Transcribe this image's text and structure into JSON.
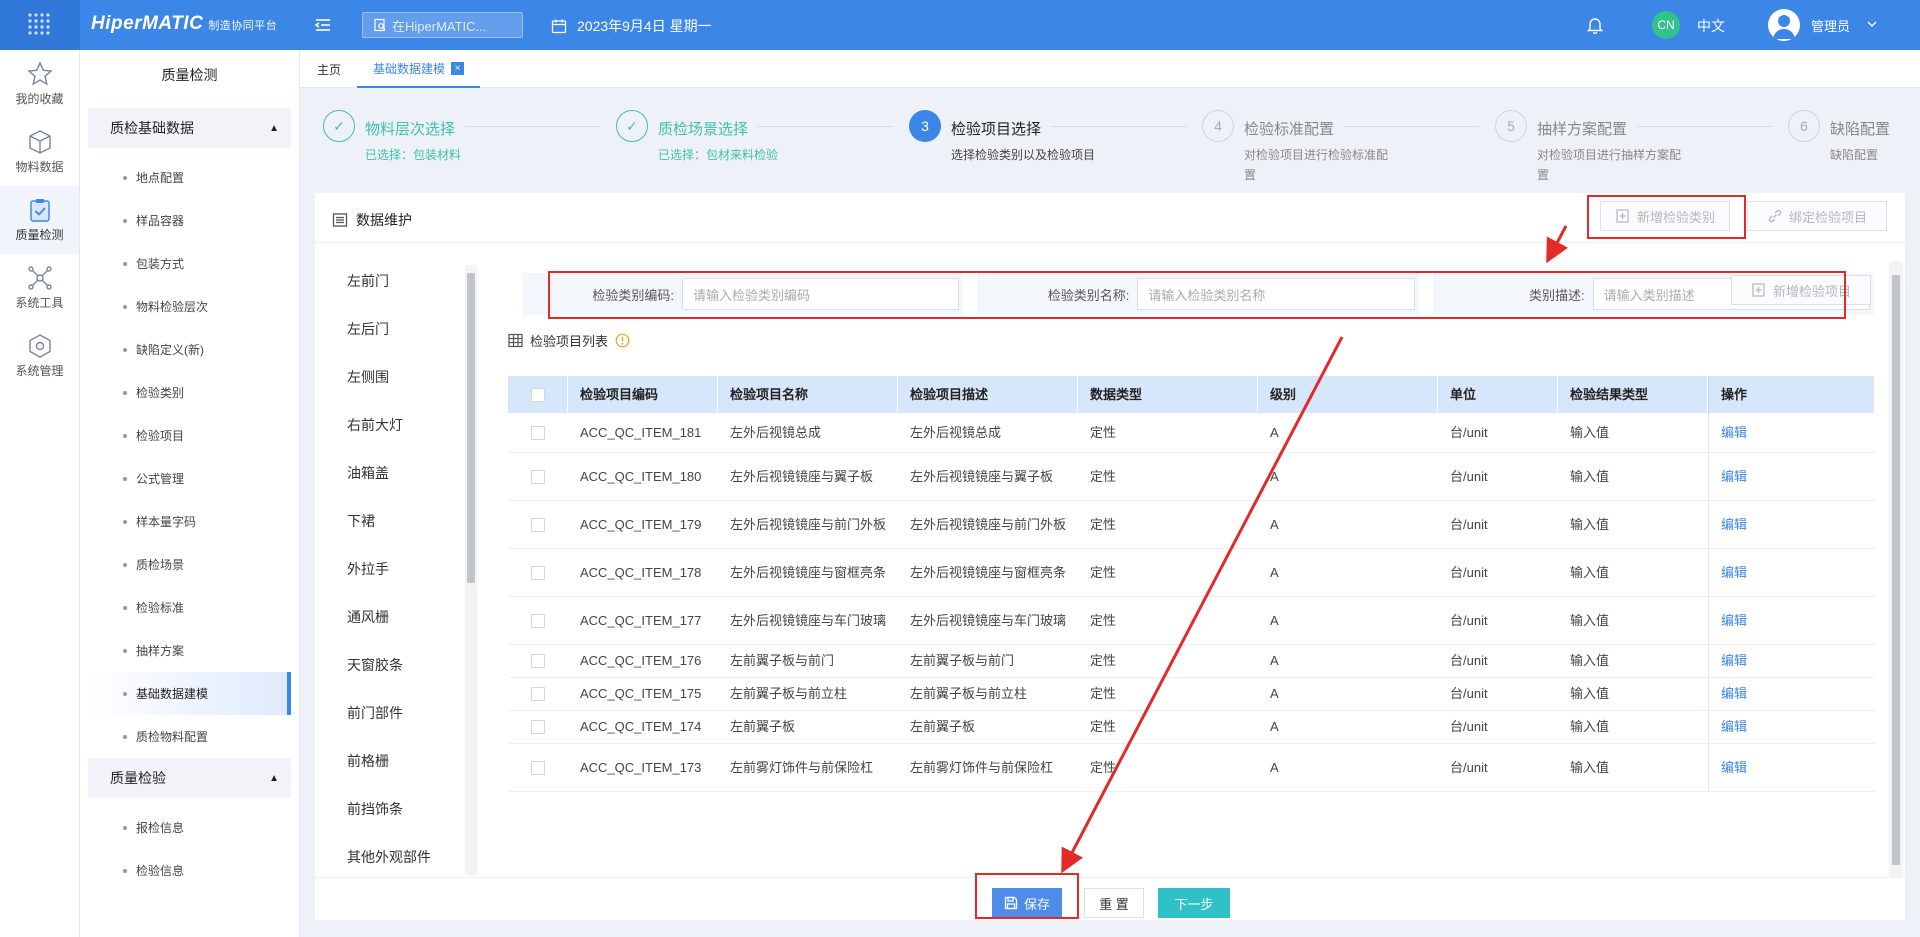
{
  "app": {
    "logo": "HiperMATIC",
    "logo_sub": "制造协同平台",
    "search_placeholder": "在HiperMATIC...",
    "date": "2023年9月4日 星期一",
    "lang_badge": "CN",
    "lang": "中文",
    "user": "管理员"
  },
  "leftnav": [
    {
      "label": "我的收藏",
      "icon": "star-icon"
    },
    {
      "label": "物料数据",
      "icon": "box-icon"
    },
    {
      "label": "质量检测",
      "icon": "quality-shield-icon"
    },
    {
      "label": "系统工具",
      "icon": "network-icon"
    },
    {
      "label": "系统管理",
      "icon": "hexagon-icon"
    }
  ],
  "sidebar": {
    "title": "质量检测",
    "group1": "质检基础数据",
    "items1": [
      "地点配置",
      "样品容器",
      "包装方式",
      "物料检验层次",
      "缺陷定义(新)",
      "检验类别",
      "检验项目",
      "公式管理",
      "样本量字码",
      "质检场景",
      "检验标准",
      "抽样方案",
      "基础数据建模",
      "质检物料配置"
    ],
    "group2": "质量检验",
    "items2": [
      "报检信息",
      "检验信息"
    ]
  },
  "tabs": {
    "home": "主页",
    "current": "基础数据建模",
    "close": "×"
  },
  "steps": [
    {
      "num": "✓",
      "title": "物料层次选择",
      "desc": "已选择：包装材料"
    },
    {
      "num": "✓",
      "title": "质检场景选择",
      "desc": "已选择：包材来料检验"
    },
    {
      "num": "3",
      "title": "检验项目选择",
      "desc": "选择检验类别以及检验项目"
    },
    {
      "num": "4",
      "title": "检验标准配置",
      "desc": "对检验项目进行检验标准配置"
    },
    {
      "num": "5",
      "title": "抽样方案配置",
      "desc": "对检验项目进行抽样方案配置"
    },
    {
      "num": "6",
      "title": "缺陷配置",
      "desc": "缺陷配置"
    }
  ],
  "panel": {
    "title": "数据维护",
    "add_category": "新增检验类别",
    "bind_item": "绑定检验项目",
    "list_title": "检验项目列表",
    "add_item": "新增检验项目"
  },
  "categories": [
    "左前门",
    "左后门",
    "左侧围",
    "右前大灯",
    "油箱盖",
    "下裙",
    "外拉手",
    "通风栅",
    "天窗胶条",
    "前门部件",
    "前格栅",
    "前挡饰条",
    "其他外观部件"
  ],
  "filters": [
    {
      "label": "检验类别编码:",
      "placeholder": "请输入检验类别编码"
    },
    {
      "label": "检验类别名称:",
      "placeholder": "请输入检验类别名称"
    },
    {
      "label": "类别描述:",
      "placeholder": "请输入类别描述"
    }
  ],
  "table": {
    "headers": [
      "检验项目编码",
      "检验项目名称",
      "检验项目描述",
      "数据类型",
      "级别",
      "单位",
      "检验结果类型",
      "操作"
    ],
    "rows": [
      [
        "ACC_QC_ITEM_181",
        "左外后视镜总成",
        "左外后视镜总成",
        "定性",
        "A",
        "台/unit",
        "输入值",
        "编辑"
      ],
      [
        "ACC_QC_ITEM_180",
        "左外后视镜镜座与翼子板",
        "左外后视镜镜座与翼子板",
        "定性",
        "A",
        "台/unit",
        "输入值",
        "编辑"
      ],
      [
        "ACC_QC_ITEM_179",
        "左外后视镜镜座与前门外板",
        "左外后视镜镜座与前门外板",
        "定性",
        "A",
        "台/unit",
        "输入值",
        "编辑"
      ],
      [
        "ACC_QC_ITEM_178",
        "左外后视镜镜座与窗框亮条",
        "左外后视镜镜座与窗框亮条",
        "定性",
        "A",
        "台/unit",
        "输入值",
        "编辑"
      ],
      [
        "ACC_QC_ITEM_177",
        "左外后视镜镜座与车门玻璃",
        "左外后视镜镜座与车门玻璃",
        "定性",
        "A",
        "台/unit",
        "输入值",
        "编辑"
      ],
      [
        "ACC_QC_ITEM_176",
        "左前翼子板与前门",
        "左前翼子板与前门",
        "定性",
        "A",
        "台/unit",
        "输入值",
        "编辑"
      ],
      [
        "ACC_QC_ITEM_175",
        "左前翼子板与前立柱",
        "左前翼子板与前立柱",
        "定性",
        "A",
        "台/unit",
        "输入值",
        "编辑"
      ],
      [
        "ACC_QC_ITEM_174",
        "左前翼子板",
        "左前翼子板",
        "定性",
        "A",
        "台/unit",
        "输入值",
        "编辑"
      ],
      [
        "ACC_QC_ITEM_173",
        "左前雾灯饰件与前保险杠",
        "左前雾灯饰件与前保险杠",
        "定性",
        "A",
        "台/unit",
        "输入值",
        "编辑"
      ]
    ]
  },
  "footer": {
    "save": "保存",
    "reset": "重 置",
    "next": "下一步"
  },
  "colors": {
    "primary": "#3b86e6",
    "success": "#3fbfae",
    "next_button": "#2ec1c5",
    "annotation": "#e22a2a"
  }
}
